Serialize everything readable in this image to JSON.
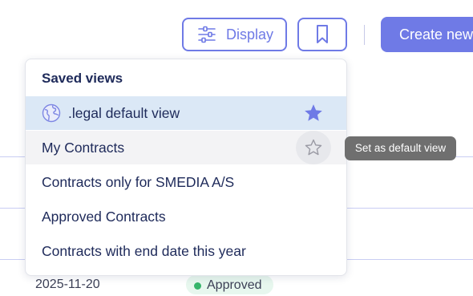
{
  "toolbar": {
    "display_label": "Display",
    "create_label": "Create new"
  },
  "saved_views": {
    "title": "Saved views",
    "items": [
      {
        "label": ".legal default view",
        "is_default": true
      },
      {
        "label": "My Contracts",
        "is_default": false
      },
      {
        "label": "Contracts only for SMEDIA A/S",
        "is_default": false
      },
      {
        "label": "Approved Contracts",
        "is_default": false
      },
      {
        "label": "Contracts with end date this year",
        "is_default": false
      }
    ]
  },
  "tooltip": {
    "text": "Set as default view"
  },
  "background_row": {
    "date": "2025-11-20",
    "status": "Approved"
  },
  "colors": {
    "accent": "#6f7ae6",
    "selected_bg": "#dbe8f6",
    "tooltip_bg": "#6f6f6f",
    "status_green": "#37b56b"
  },
  "icons": [
    "sliders-icon",
    "bookmark-icon",
    "globe-icon",
    "star-filled-icon",
    "star-outline-icon"
  ]
}
